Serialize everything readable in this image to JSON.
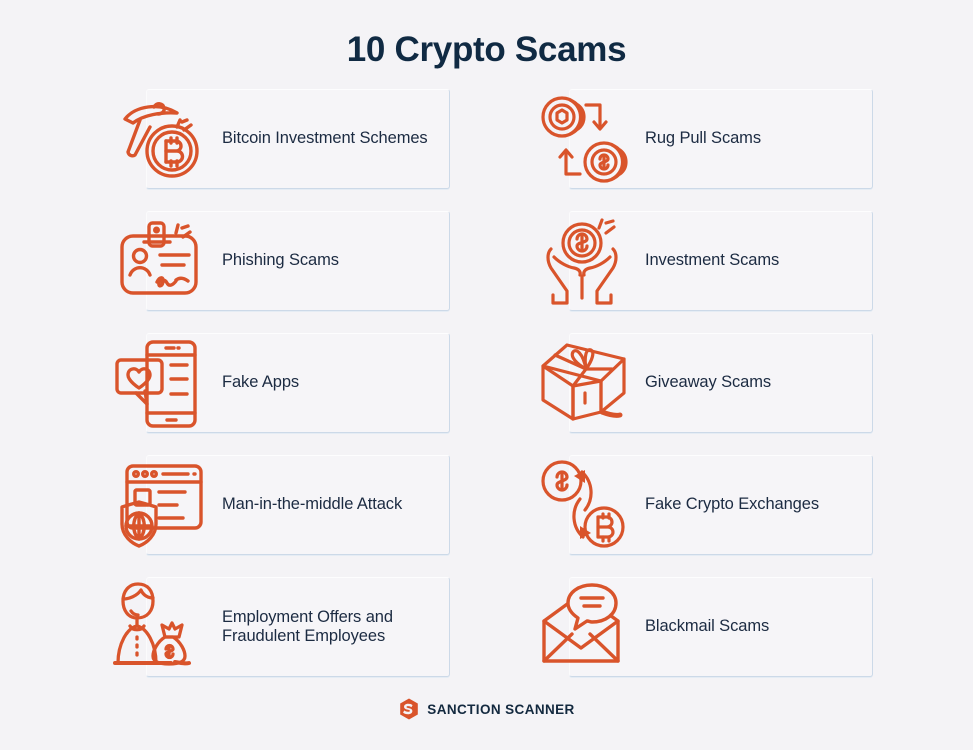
{
  "page": {
    "background_color": "#f4f3f6",
    "title": "10 Crypto Scams",
    "title_color": "#102a43",
    "accent_color": "#d9542b",
    "text_color": "#1c2b42",
    "card_color": "#f6f5f8",
    "card_shadow_color": "#ccd9e8"
  },
  "cards": [
    {
      "label": "Bitcoin Investment Schemes",
      "icon": "pickaxe-bitcoin-icon",
      "column": "left",
      "row": 1
    },
    {
      "label": "Rug Pull Scams",
      "icon": "coins-swap-arrows-icon",
      "column": "right",
      "row": 1
    },
    {
      "label": "Phishing Scams",
      "icon": "id-badge-icon",
      "column": "left",
      "row": 2
    },
    {
      "label": "Investment Scams",
      "icon": "hands-holding-coin-icon",
      "column": "right",
      "row": 2
    },
    {
      "label": "Fake Apps",
      "icon": "phone-heart-bubble-icon",
      "column": "left",
      "row": 3
    },
    {
      "label": "Giveaway Scams",
      "icon": "gift-box-icon",
      "column": "right",
      "row": 3
    },
    {
      "label": "Man-in-the-middle Attack",
      "icon": "browser-shield-globe-icon",
      "column": "left",
      "row": 4
    },
    {
      "label": "Fake Crypto Exchanges",
      "icon": "dollar-bitcoin-exchange-icon",
      "column": "right",
      "row": 4
    },
    {
      "label": "Employment Offers and Fraudulent Employees",
      "icon": "person-money-bag-icon",
      "column": "left",
      "row": 5
    },
    {
      "label": "Blackmail Scams",
      "icon": "envelope-speech-bubble-icon",
      "column": "right",
      "row": 5
    }
  ],
  "footer": {
    "brand": "SANCTION SCANNER",
    "logo_icon": "sanction-scanner-hexagon-s-logo",
    "logo_color": "#d9542b"
  }
}
